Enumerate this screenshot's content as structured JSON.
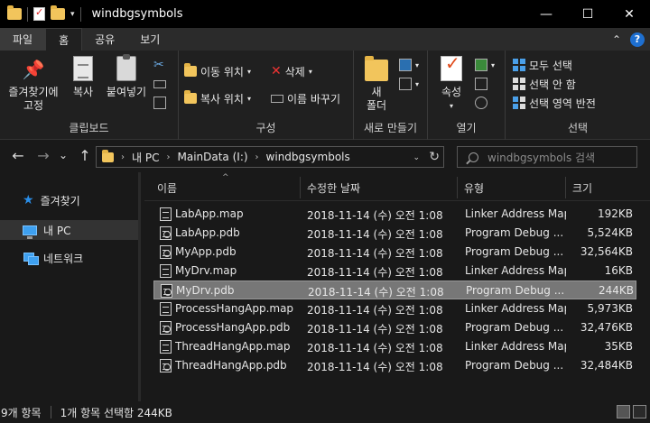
{
  "window": {
    "title": "windbgsymbols",
    "minimize": "—",
    "maximize": "☐",
    "close": "✕"
  },
  "quick_access": {
    "dropdown": "▾"
  },
  "tabs": [
    {
      "label": "파일"
    },
    {
      "label": "홈"
    },
    {
      "label": "공유"
    },
    {
      "label": "보기"
    }
  ],
  "tabs_right": {
    "collapse": "⌃",
    "help": "?"
  },
  "ribbon": {
    "clipboard": {
      "label": "클립보드",
      "pin": "즐겨찾기에\n고정",
      "copy": "복사",
      "paste": "붙여넣기"
    },
    "organize": {
      "label": "구성",
      "move_to": "이동 위치",
      "copy_to": "복사 위치",
      "delete": "삭제",
      "rename": "이름 바꾸기"
    },
    "new": {
      "label": "새로 만들기",
      "new_folder": "새\n폴더"
    },
    "open": {
      "label": "열기",
      "properties": "속성"
    },
    "select": {
      "label": "선택",
      "select_all": "모두 선택",
      "select_none": "선택 안 함",
      "invert": "선택 영역 반전"
    }
  },
  "nav": {
    "back": "←",
    "forward": "→",
    "dropdown": "⌄",
    "up": "↑",
    "breadcrumb": [
      "내 PC",
      "MainData (I:)",
      "windbgsymbols"
    ],
    "breadcrumb_sep": "›",
    "refresh": "↻",
    "search_placeholder": "windbgsymbols 검색"
  },
  "sidebar": {
    "items": [
      {
        "label": "즐겨찾기"
      },
      {
        "label": "내 PC"
      },
      {
        "label": "네트워크"
      }
    ]
  },
  "columns": {
    "name": "이름",
    "date": "수정한 날짜",
    "type": "유형",
    "size": "크기",
    "sort_indicator": "^"
  },
  "files": [
    {
      "name": "LabApp.map",
      "date": "2018-11-14 (수) 오전 1:08",
      "type": "Linker Address Map",
      "size": "192KB",
      "kind": "map"
    },
    {
      "name": "LabApp.pdb",
      "date": "2018-11-14 (수) 오전 1:08",
      "type": "Program Debug ...",
      "size": "5,524KB",
      "kind": "pdb"
    },
    {
      "name": "MyApp.pdb",
      "date": "2018-11-14 (수) 오전 1:08",
      "type": "Program Debug ...",
      "size": "32,564KB",
      "kind": "pdb"
    },
    {
      "name": "MyDrv.map",
      "date": "2018-11-14 (수) 오전 1:08",
      "type": "Linker Address Map",
      "size": "16KB",
      "kind": "map"
    },
    {
      "name": "MyDrv.pdb",
      "date": "2018-11-14 (수) 오전 1:08",
      "type": "Program Debug ...",
      "size": "244KB",
      "kind": "pdb",
      "selected": true
    },
    {
      "name": "ProcessHangApp.map",
      "date": "2018-11-14 (수) 오전 1:08",
      "type": "Linker Address Map",
      "size": "5,973KB",
      "kind": "map"
    },
    {
      "name": "ProcessHangApp.pdb",
      "date": "2018-11-14 (수) 오전 1:08",
      "type": "Program Debug ...",
      "size": "32,476KB",
      "kind": "pdb"
    },
    {
      "name": "ThreadHangApp.map",
      "date": "2018-11-14 (수) 오전 1:08",
      "type": "Linker Address Map",
      "size": "35KB",
      "kind": "map"
    },
    {
      "name": "ThreadHangApp.pdb",
      "date": "2018-11-14 (수) 오전 1:08",
      "type": "Program Debug ...",
      "size": "32,484KB",
      "kind": "pdb"
    }
  ],
  "status": {
    "count": "9개 항목",
    "selection": "1개 항목 선택함 244KB"
  }
}
